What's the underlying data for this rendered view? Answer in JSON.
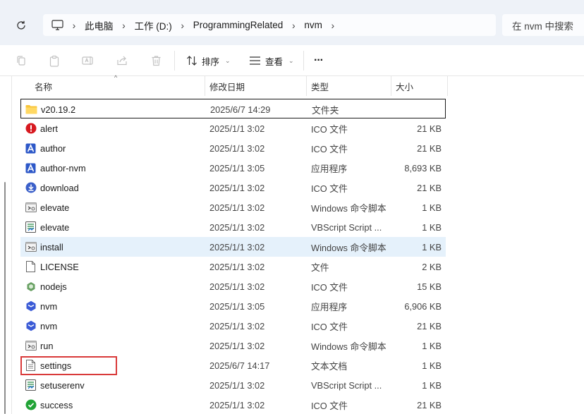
{
  "address": {
    "crumbs": [
      "此电脑",
      "工作 (D:)",
      "ProgrammingRelated",
      "nvm"
    ],
    "search_placeholder": "在 nvm 中搜索"
  },
  "toolbar": {
    "sort_label": "排序",
    "view_label": "查看",
    "more_label": "···"
  },
  "columns": {
    "name": "名称",
    "date": "修改日期",
    "type": "类型",
    "size": "大小"
  },
  "files": [
    {
      "name": "v20.19.2",
      "date": "2025/6/7 14:29",
      "type": "文件夹",
      "size": "",
      "icon": "folder-icon"
    },
    {
      "name": "alert",
      "date": "2025/1/1 3:02",
      "type": "ICO 文件",
      "size": "21 KB",
      "icon": "alert-icon"
    },
    {
      "name": "author",
      "date": "2025/1/1 3:02",
      "type": "ICO 文件",
      "size": "21 KB",
      "icon": "author-icon"
    },
    {
      "name": "author-nvm",
      "date": "2025/1/1 3:05",
      "type": "应用程序",
      "size": "8,693 KB",
      "icon": "author-app-icon"
    },
    {
      "name": "download",
      "date": "2025/1/1 3:02",
      "type": "ICO 文件",
      "size": "21 KB",
      "icon": "download-icon"
    },
    {
      "name": "elevate",
      "date": "2025/1/1 3:02",
      "type": "Windows 命令脚本",
      "size": "1 KB",
      "icon": "cmd-script-icon"
    },
    {
      "name": "elevate",
      "date": "2025/1/1 3:02",
      "type": "VBScript Script ...",
      "size": "1 KB",
      "icon": "vbscript-icon"
    },
    {
      "name": "install",
      "date": "2025/1/1 3:02",
      "type": "Windows 命令脚本",
      "size": "1 KB",
      "icon": "cmd-script-icon"
    },
    {
      "name": "LICENSE",
      "date": "2025/1/1 3:02",
      "type": "文件",
      "size": "2 KB",
      "icon": "file-icon"
    },
    {
      "name": "nodejs",
      "date": "2025/1/1 3:02",
      "type": "ICO 文件",
      "size": "15 KB",
      "icon": "nodejs-icon"
    },
    {
      "name": "nvm",
      "date": "2025/1/1 3:05",
      "type": "应用程序",
      "size": "6,906 KB",
      "icon": "nvm-icon"
    },
    {
      "name": "nvm",
      "date": "2025/1/1 3:02",
      "type": "ICO 文件",
      "size": "21 KB",
      "icon": "nvm-icon"
    },
    {
      "name": "run",
      "date": "2025/1/1 3:02",
      "type": "Windows 命令脚本",
      "size": "1 KB",
      "icon": "cmd-script-icon"
    },
    {
      "name": "settings",
      "date": "2025/6/7 14:17",
      "type": "文本文档",
      "size": "1 KB",
      "icon": "text-document-icon"
    },
    {
      "name": "setuserenv",
      "date": "2025/1/1 3:02",
      "type": "VBScript Script ...",
      "size": "1 KB",
      "icon": "vbscript-icon"
    },
    {
      "name": "success",
      "date": "2025/1/1 3:02",
      "type": "ICO 文件",
      "size": "21 KB",
      "icon": "success-icon"
    }
  ],
  "colors": {
    "folder": "#f8c53a",
    "alert": "#d71920",
    "author": "#2d58c8",
    "nvm": "#3b5bd6",
    "success": "#21a336",
    "nodejs": "#68a063",
    "hover_row": "#e5f1fb",
    "highlight_box": "#d93a3a"
  }
}
